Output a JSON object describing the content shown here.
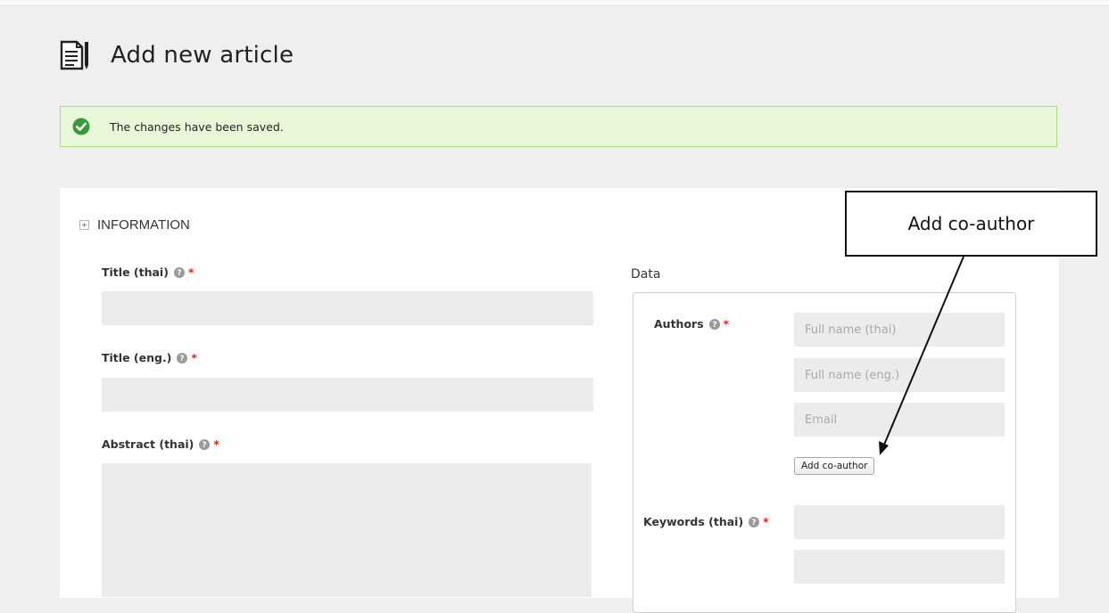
{
  "page": {
    "title": "Add new article"
  },
  "alert": {
    "message": "The changes have been saved."
  },
  "form": {
    "section_title": "INFORMATION",
    "title_thai_label": "Title (thai)",
    "title_eng_label": "Title (eng.)",
    "abstract_thai_label": "Abstract (thai)",
    "required_mark": "*",
    "data_title": "Data",
    "authors_label": "Authors",
    "fullname_thai_placeholder": "Full name (thai)",
    "fullname_eng_placeholder": "Full name (eng.)",
    "email_placeholder": "Email",
    "add_coauthor_label": "Add co-author",
    "keywords_thai_label": "Keywords (thai)"
  },
  "annotation": {
    "callout_text": "Add co-author"
  },
  "colors": {
    "success_bg": "#e9f7d9",
    "success_border": "#a9dc83",
    "success_icon": "#3a9a3a",
    "required": "#d9281e"
  },
  "icons": [
    "document-edit-icon",
    "check-circle-icon",
    "expand-plus-icon",
    "help-icon"
  ]
}
